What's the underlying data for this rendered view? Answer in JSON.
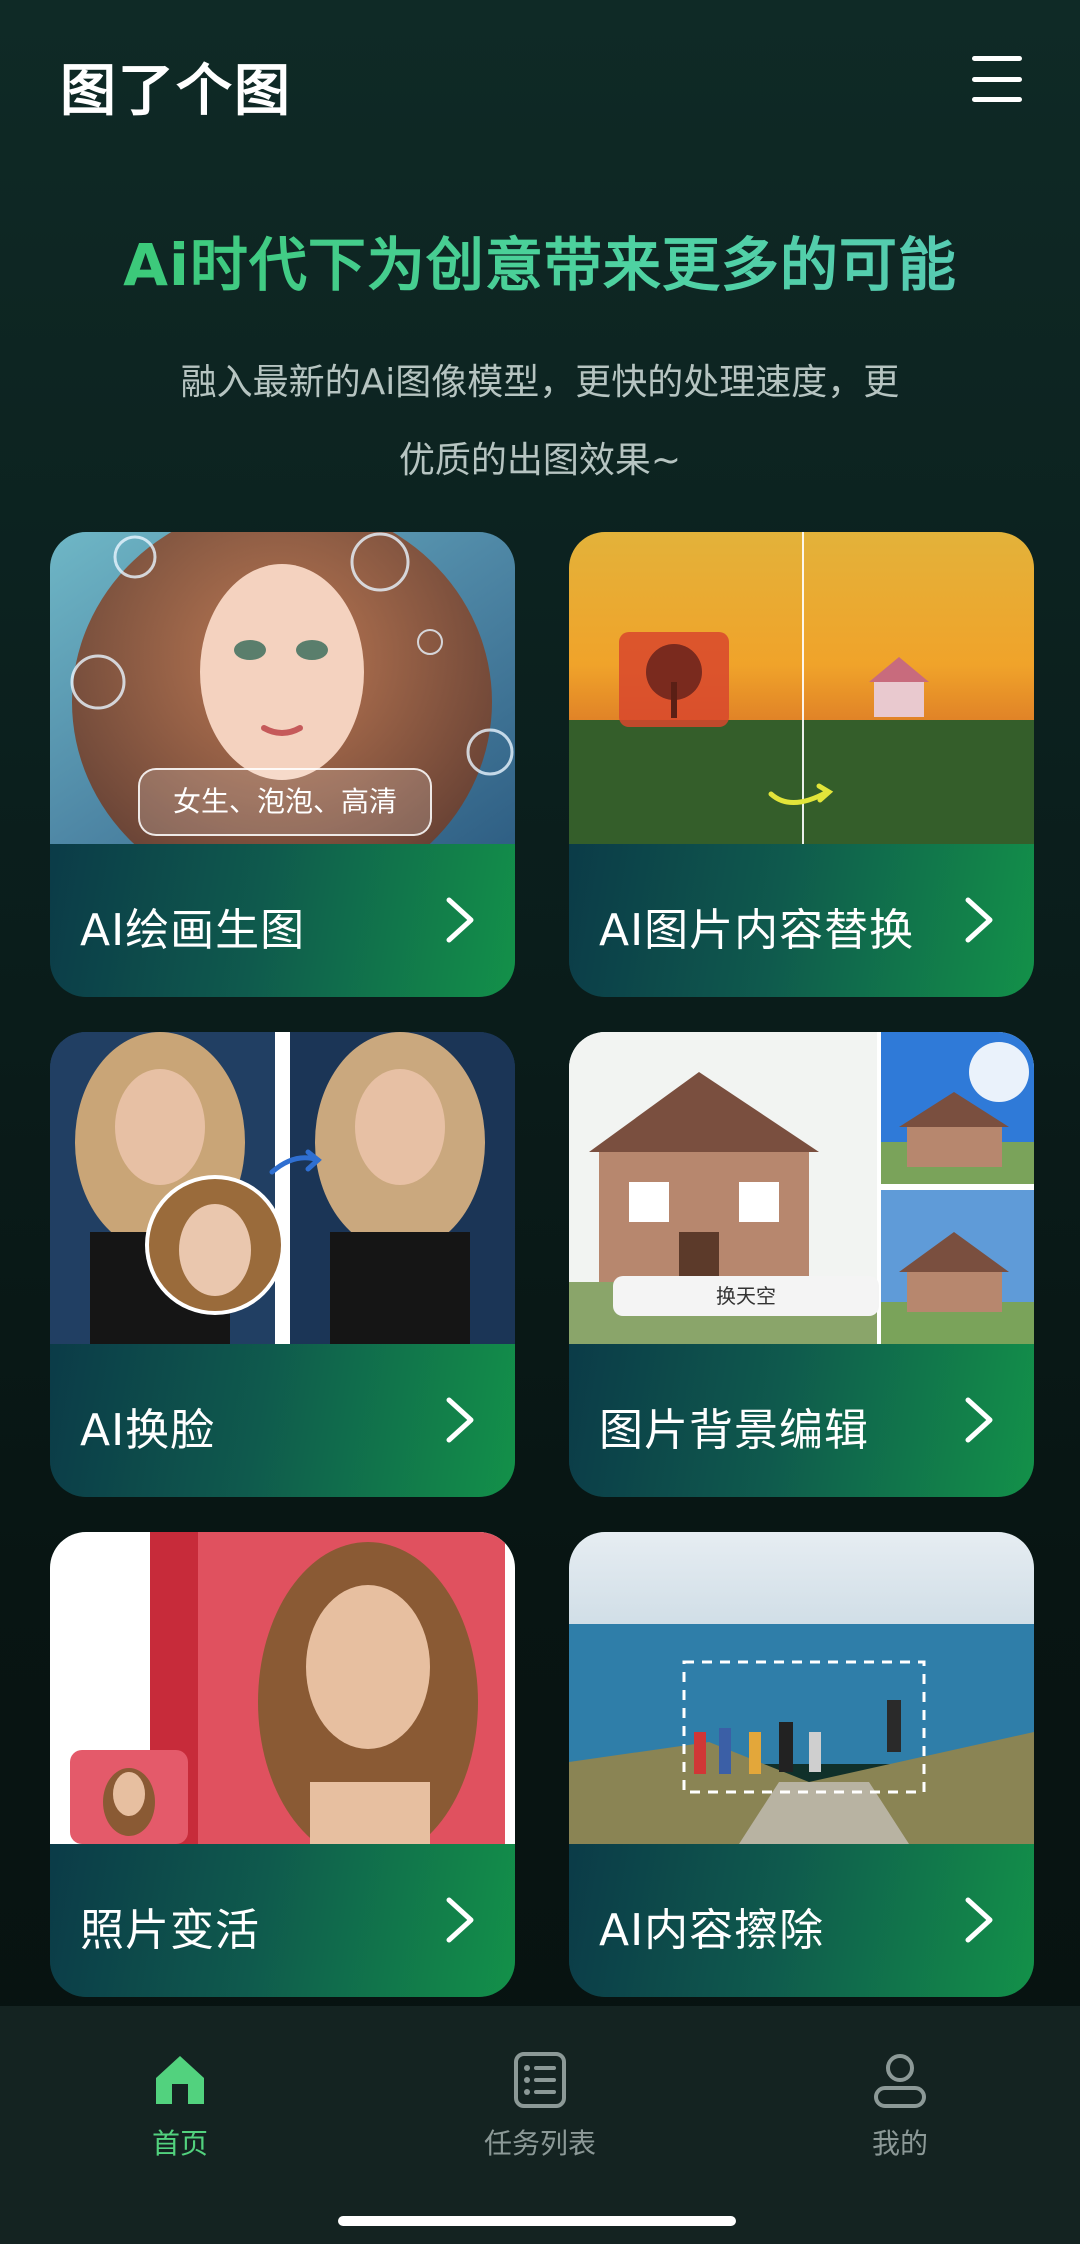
{
  "app": {
    "title": "图了个图"
  },
  "header": {
    "menu_icon": "hamburger-menu-icon"
  },
  "hero": {
    "headline": "Ai时代下为创意带来更多的可能",
    "subline": "融入最新的Ai图像模型，更快的处理速度，更优质的出图效果~"
  },
  "features": [
    {
      "label": "AI绘画生图",
      "overlay": "女生、泡泡、高清"
    },
    {
      "label": "AI图片内容替换"
    },
    {
      "label": "AI换脸"
    },
    {
      "label": "图片背景编辑",
      "overlay": "换天空"
    },
    {
      "label": "照片变活"
    },
    {
      "label": "AI内容擦除"
    }
  ],
  "bottom_nav": [
    {
      "label": "首页",
      "icon": "home-icon",
      "active": true
    },
    {
      "label": "任务列表",
      "icon": "task-list-icon",
      "active": false
    },
    {
      "label": "我的",
      "icon": "profile-icon",
      "active": false
    }
  ],
  "colors": {
    "accent": "#52d27e",
    "card_footer_start": "#0b3b48",
    "card_footer_end": "#139149",
    "background": "#0b1f1d"
  }
}
